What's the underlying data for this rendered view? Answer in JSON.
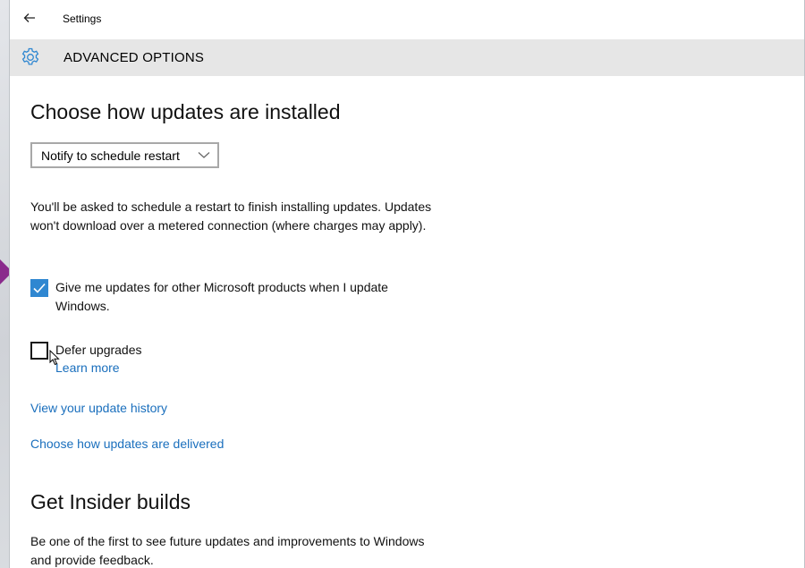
{
  "window": {
    "app_title": "Settings",
    "page_title": "ADVANCED OPTIONS"
  },
  "updates": {
    "heading": "Choose how updates are installed",
    "install_mode": "Notify to schedule restart",
    "description": "You'll be asked to schedule a restart to finish installing updates. Updates won't download over a metered connection (where charges may apply).",
    "microsoft_products": {
      "label": "Give me updates for other Microsoft products when I update Windows.",
      "checked": true
    },
    "defer_upgrades": {
      "label": "Defer upgrades",
      "checked": false,
      "learn_more": "Learn more"
    },
    "history_link": "View your update history",
    "delivery_link": "Choose how updates are delivered"
  },
  "insider": {
    "heading": "Get Insider builds",
    "description": "Be one of the first to see future updates and improvements to Windows and provide feedback."
  },
  "colors": {
    "accent": "#2f87d1",
    "link": "#1a6fbd",
    "header_bg": "#e6e6e6"
  },
  "icons": {
    "back": "back-arrow-icon",
    "settings": "gear-icon",
    "dropdown": "chevron-down-icon",
    "checkmark": "checkmark-icon",
    "pointer": "mouse-cursor-icon"
  }
}
